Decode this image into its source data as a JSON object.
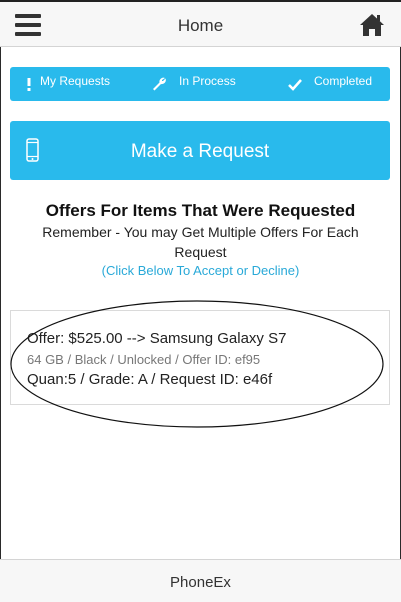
{
  "header": {
    "title": "Home",
    "menu_icon": "hamburger-menu-icon",
    "home_icon": "home-icon"
  },
  "nav": {
    "items": [
      {
        "label": "My Requests",
        "icon": "exclamation-icon"
      },
      {
        "label": "In Process",
        "icon": "wrench-icon"
      },
      {
        "label": "Completed",
        "icon": "checkmark-icon"
      }
    ]
  },
  "request_button": {
    "label": "Make a Request",
    "icon": "smartphone-icon"
  },
  "offers": {
    "heading": "Offers For Items That Were Requested",
    "subtext": "Remember - You may Get Multiple Offers For Each Request",
    "hint": "(Click Below To Accept or Decline)",
    "items": [
      {
        "line1": "Offer: $525.00 --> Samsung Galaxy S7",
        "line2": "64 GB / Black / Unlocked / Offer ID: ef95",
        "line3": "Quan:5 / Grade: A / Request ID: e46f"
      }
    ]
  },
  "footer": {
    "label": "PhoneEx"
  },
  "colors": {
    "accent": "#29baec",
    "link": "#29a9d8",
    "header_bg": "#f7f7f7"
  }
}
